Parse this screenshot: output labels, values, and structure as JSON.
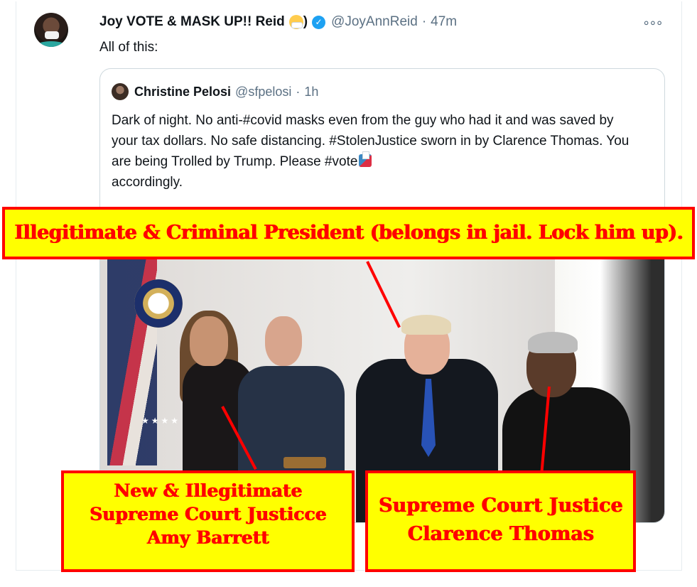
{
  "tweet": {
    "display_name": "Joy VOTE & MASK UP!! Reid",
    "name_suffix": ")",
    "handle": "@JoyAnnReid",
    "separator": "·",
    "time": "47m",
    "more_glyph": "∘∘∘",
    "verified_glyph": "✓",
    "text": "All of this:",
    "icons": [
      "avatar",
      "mask-face-emoji",
      "verified-badge-icon",
      "more-options-icon"
    ]
  },
  "quoted_tweet": {
    "display_name": "Christine Pelosi",
    "handle": "@sfpelosi",
    "separator": "·",
    "time": "1h",
    "text": "Dark of night. No anti-#covid masks even from the guy who had it and was saved by your tax dollars. No safe distancing. #StolenJustice sworn in by Clarence Thomas. You are being Trolled by Trump. Please #vote",
    "text_end": "accordingly.",
    "icons": [
      "ballot-box-emoji"
    ]
  },
  "annotations": {
    "president": "Illegitimate & Criminal President (belongs in jail. Lock him up).",
    "barrett_line1": "New & Illegitimate",
    "barrett_line2": "Supreme Court Justicce",
    "barrett_line3": "Amy Barrett",
    "thomas_line1": "Supreme Court Justice",
    "thomas_line2": "Clarence Thomas"
  },
  "colors": {
    "callout_fill": "#ffff00",
    "callout_text": "#ff0000",
    "verified_blue": "#1da1f2",
    "secondary_text": "#5b7083"
  }
}
